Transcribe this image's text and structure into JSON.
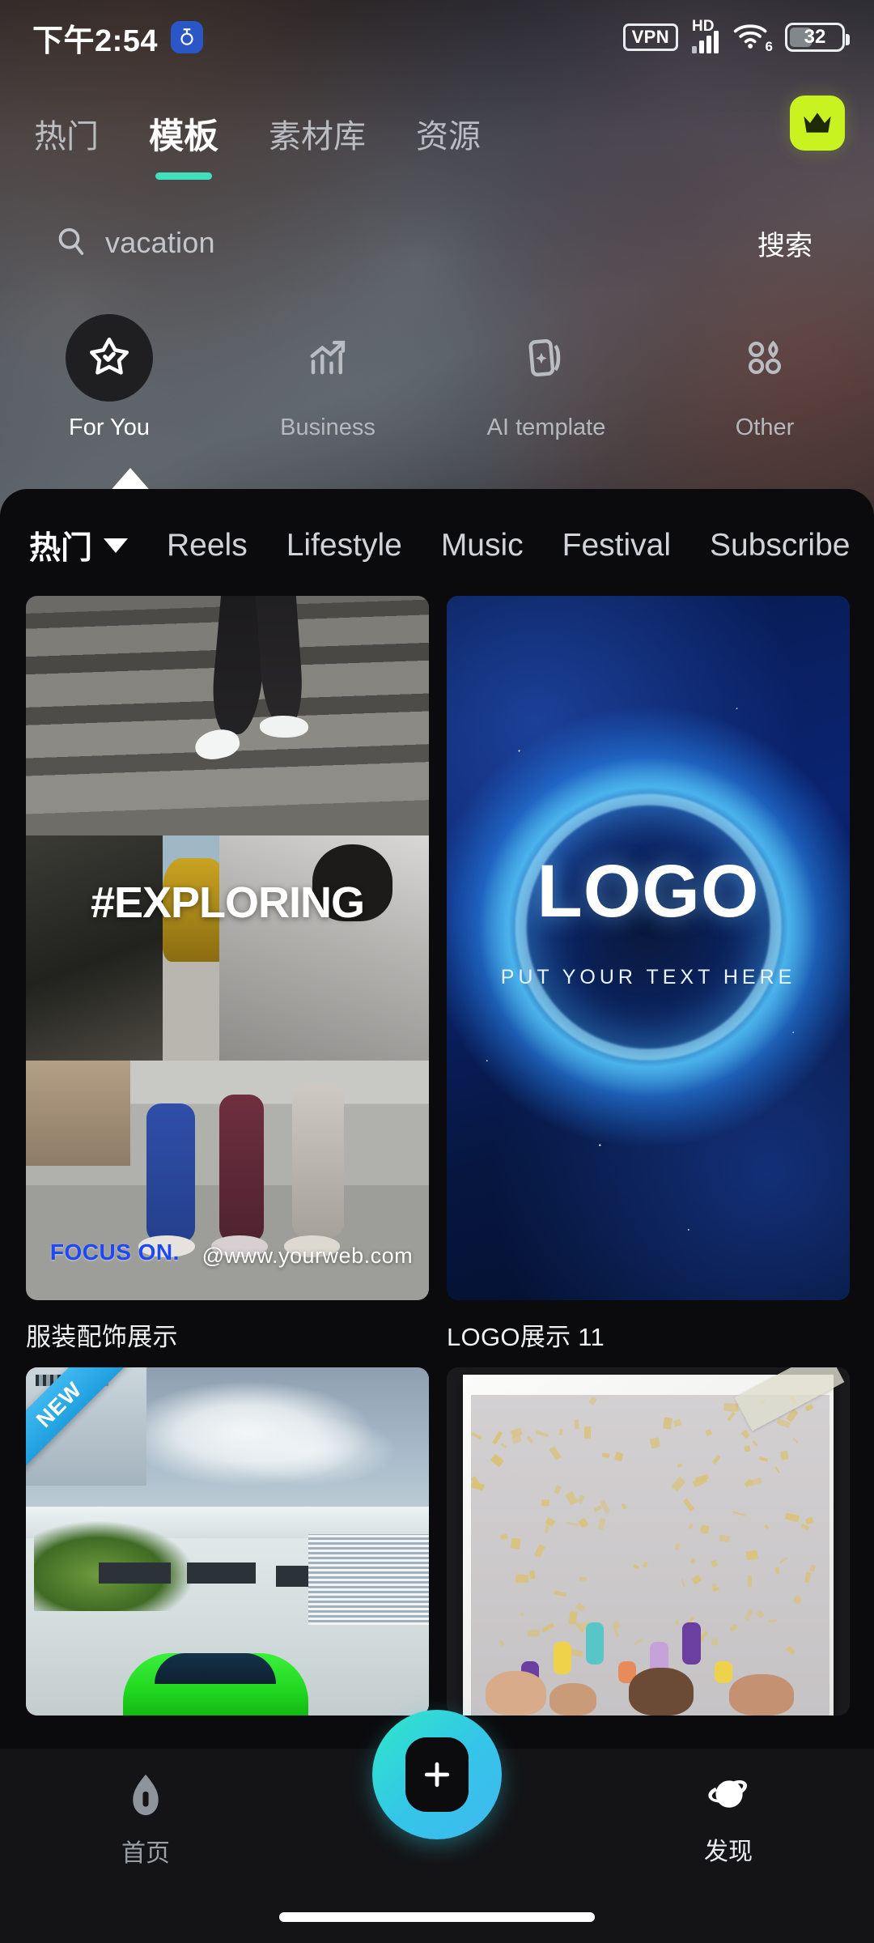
{
  "status_bar": {
    "time": "下午2:54",
    "app_icon": "timer-icon",
    "vpn": "VPN",
    "network_type": "HD",
    "wifi_generation": "6",
    "battery_level": "32"
  },
  "top_tabs": {
    "items": [
      {
        "label": "热门",
        "active": false
      },
      {
        "label": "模板",
        "active": true
      },
      {
        "label": "素材库",
        "active": false
      },
      {
        "label": "资源",
        "active": false
      }
    ],
    "pro_badge": "crown-icon",
    "accent_color": "#3fe0bb"
  },
  "search": {
    "icon": "search-icon",
    "value": "vacation",
    "placeholder": "vacation",
    "button_label": "搜索"
  },
  "categories": [
    {
      "label": "For You",
      "icon": "star-badge-icon",
      "active": true
    },
    {
      "label": "Business",
      "icon": "bar-chart-up-icon",
      "active": false
    },
    {
      "label": "AI template",
      "icon": "ai-card-sparkle-icon",
      "active": false
    },
    {
      "label": "Other",
      "icon": "four-shapes-icon",
      "active": false
    }
  ],
  "sub_nav": {
    "items": [
      {
        "label": "热门",
        "active": true,
        "has_caret": true
      },
      {
        "label": "Reels",
        "active": false
      },
      {
        "label": "Lifestyle",
        "active": false
      },
      {
        "label": "Music",
        "active": false
      },
      {
        "label": "Festival",
        "active": false
      },
      {
        "label": "Subscribe",
        "active": false
      }
    ]
  },
  "templates": [
    {
      "title": "服装配饰展示",
      "overlay_main": "#EXPLORING",
      "overlay_brand": "FOCUS ON.",
      "overlay_web": "@www.yourweb.com",
      "badge": ""
    },
    {
      "title": "LOGO展示 11",
      "overlay_main": "LOGO",
      "overlay_sub": "PUT YOUR TEXT HERE",
      "badge": ""
    },
    {
      "title": "",
      "badge": "NEW"
    },
    {
      "title": "",
      "badge": ""
    }
  ],
  "bottom_nav": {
    "items": [
      {
        "label": "首页",
        "icon": "home-icon",
        "active": false
      },
      {
        "label": "发现",
        "icon": "planet-icon",
        "active": true
      }
    ],
    "create_button": {
      "icon": "plus-icon",
      "label": ""
    },
    "accent_start": "#2ee8c8",
    "accent_end": "#41b7f0"
  }
}
